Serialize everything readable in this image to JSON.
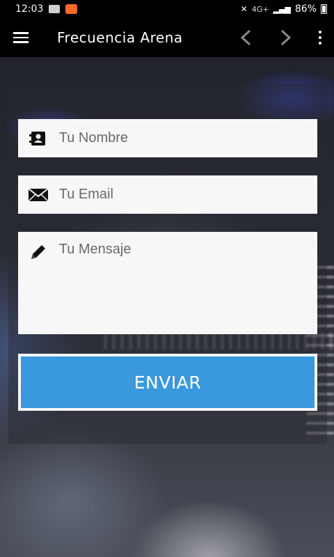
{
  "status_bar": {
    "time": "12:03",
    "network": "4G+",
    "battery": "86%"
  },
  "toolbar": {
    "title": "Frecuencia Arena"
  },
  "form": {
    "name_placeholder": "Tu Nombre",
    "email_placeholder": "Tu Email",
    "message_placeholder": "Tu Mensaje",
    "submit_label": "ENVIAR"
  },
  "icons": {
    "menu": "hamburger-menu-icon",
    "back": "chevron-left-icon",
    "forward": "chevron-right-icon",
    "more": "more-vertical-icon",
    "name": "contact-card-icon",
    "email": "envelope-icon",
    "message": "pencil-icon"
  },
  "colors": {
    "accent": "#3a99dd",
    "toolbar_bg": "#000000",
    "field_bg": "#f7f7f7"
  }
}
